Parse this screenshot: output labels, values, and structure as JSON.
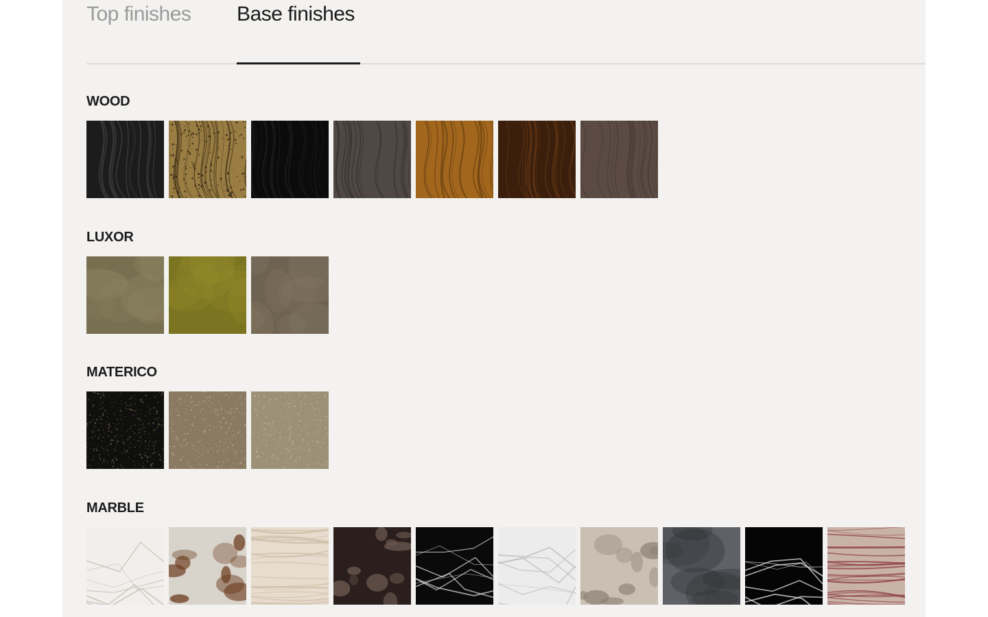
{
  "tabs": {
    "top_label": "Top finishes",
    "base_label": "Base finishes",
    "active": "base"
  },
  "sections": [
    {
      "id": "wood",
      "title": "WOOD",
      "swatches": [
        {
          "name": "wood-1",
          "base": "#1c1c1d",
          "vein": "#3b3b3d",
          "style": "grain"
        },
        {
          "name": "wood-2",
          "base": "#9a7d43",
          "vein": "#4a3a1c",
          "style": "speckle-grain"
        },
        {
          "name": "wood-3",
          "base": "#0c0b0b",
          "vein": "#1d1c1b",
          "style": "grain"
        },
        {
          "name": "wood-4",
          "base": "#4f4844",
          "vein": "#3a3431",
          "style": "grain"
        },
        {
          "name": "wood-5",
          "base": "#a2661c",
          "vein": "#6b4213",
          "style": "grain"
        },
        {
          "name": "wood-6",
          "base": "#3b1f0c",
          "vein": "#613514",
          "style": "grain"
        },
        {
          "name": "wood-7",
          "base": "#5b4b43",
          "vein": "#4b3d36",
          "style": "grain"
        }
      ]
    },
    {
      "id": "luxor",
      "title": "LUXOR",
      "swatches": [
        {
          "name": "luxor-1",
          "base": "#776f50",
          "vein": "#8d8461",
          "style": "cloud"
        },
        {
          "name": "luxor-2",
          "base": "#7b7421",
          "vein": "#968c2c",
          "style": "cloud"
        },
        {
          "name": "luxor-3",
          "base": "#6e6250",
          "vein": "#857865",
          "style": "cloud"
        }
      ]
    },
    {
      "id": "materico",
      "title": "MATERICO",
      "swatches": [
        {
          "name": "materico-1",
          "base": "#0f0f0e",
          "vein": "#8a7a55",
          "style": "dots"
        },
        {
          "name": "materico-2",
          "base": "#8a7a62",
          "vein": "#c1b196",
          "style": "dots"
        },
        {
          "name": "materico-3",
          "base": "#9c9078",
          "vein": "#c7bca4",
          "style": "dots"
        }
      ]
    },
    {
      "id": "marble",
      "title": "MARBLE",
      "swatches": [
        {
          "name": "marble-1",
          "base": "#f1efec",
          "vein": "#b9b2a6",
          "style": "veins"
        },
        {
          "name": "marble-2",
          "base": "#d8d3cb",
          "vein": "#6a3a1c",
          "style": "blotch"
        },
        {
          "name": "marble-3",
          "base": "#e7dccd",
          "vein": "#cdbda6",
          "style": "stripes"
        },
        {
          "name": "marble-4",
          "base": "#2a1f1d",
          "vein": "#6c5a50",
          "style": "blotch"
        },
        {
          "name": "marble-5",
          "base": "#0a0a0a",
          "vein": "#d9d9d9",
          "style": "veins"
        },
        {
          "name": "marble-6",
          "base": "#ececec",
          "vein": "#b8b8b8",
          "style": "veins"
        },
        {
          "name": "marble-7",
          "base": "#c9bfb3",
          "vein": "#8f8376",
          "style": "blotch"
        },
        {
          "name": "marble-8",
          "base": "#5e6166",
          "vein": "#2f3135",
          "style": "cloud"
        },
        {
          "name": "marble-9",
          "base": "#050505",
          "vein": "#f0f0f0",
          "style": "veins"
        },
        {
          "name": "marble-10",
          "base": "#c9b3a8",
          "vein": "#8c3a43",
          "style": "stripes"
        }
      ]
    }
  ]
}
